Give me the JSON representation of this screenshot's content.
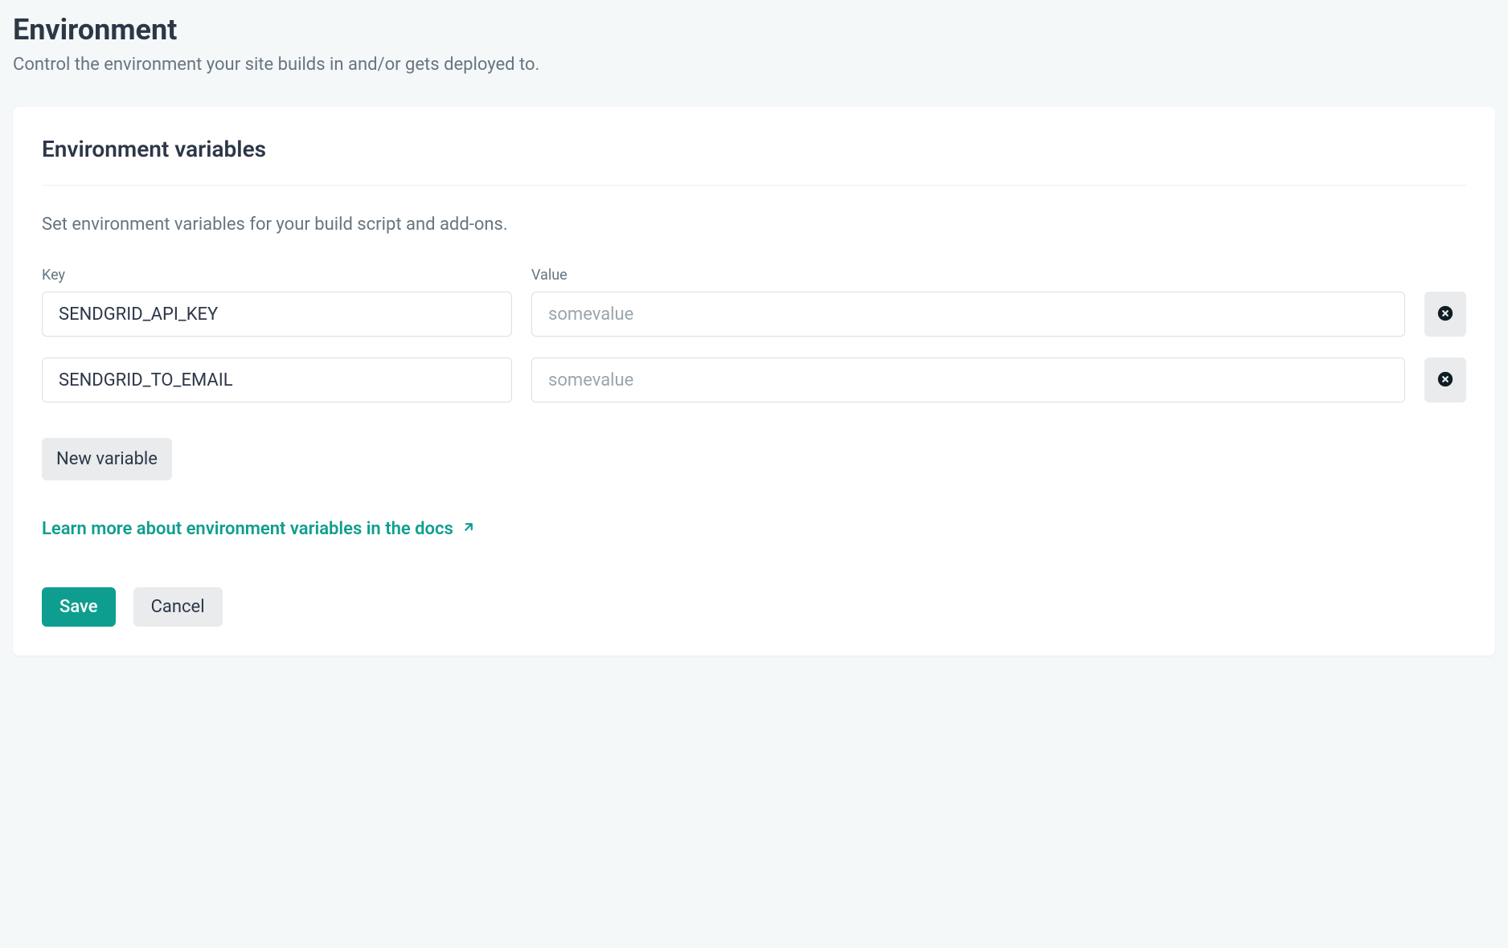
{
  "page": {
    "title": "Environment",
    "subtitle": "Control the environment your site builds in and/or gets deployed to."
  },
  "card": {
    "title": "Environment variables",
    "description": "Set environment variables for your build script and add-ons.",
    "key_label": "Key",
    "value_label": "Value",
    "variables": [
      {
        "key": "SENDGRID_API_KEY",
        "value": "",
        "placeholder": "somevalue"
      },
      {
        "key": "SENDGRID_TO_EMAIL",
        "value": "",
        "placeholder": "somevalue"
      }
    ],
    "new_variable_label": "New variable",
    "docs_link_label": "Learn more about environment variables in the docs",
    "save_label": "Save",
    "cancel_label": "Cancel"
  }
}
